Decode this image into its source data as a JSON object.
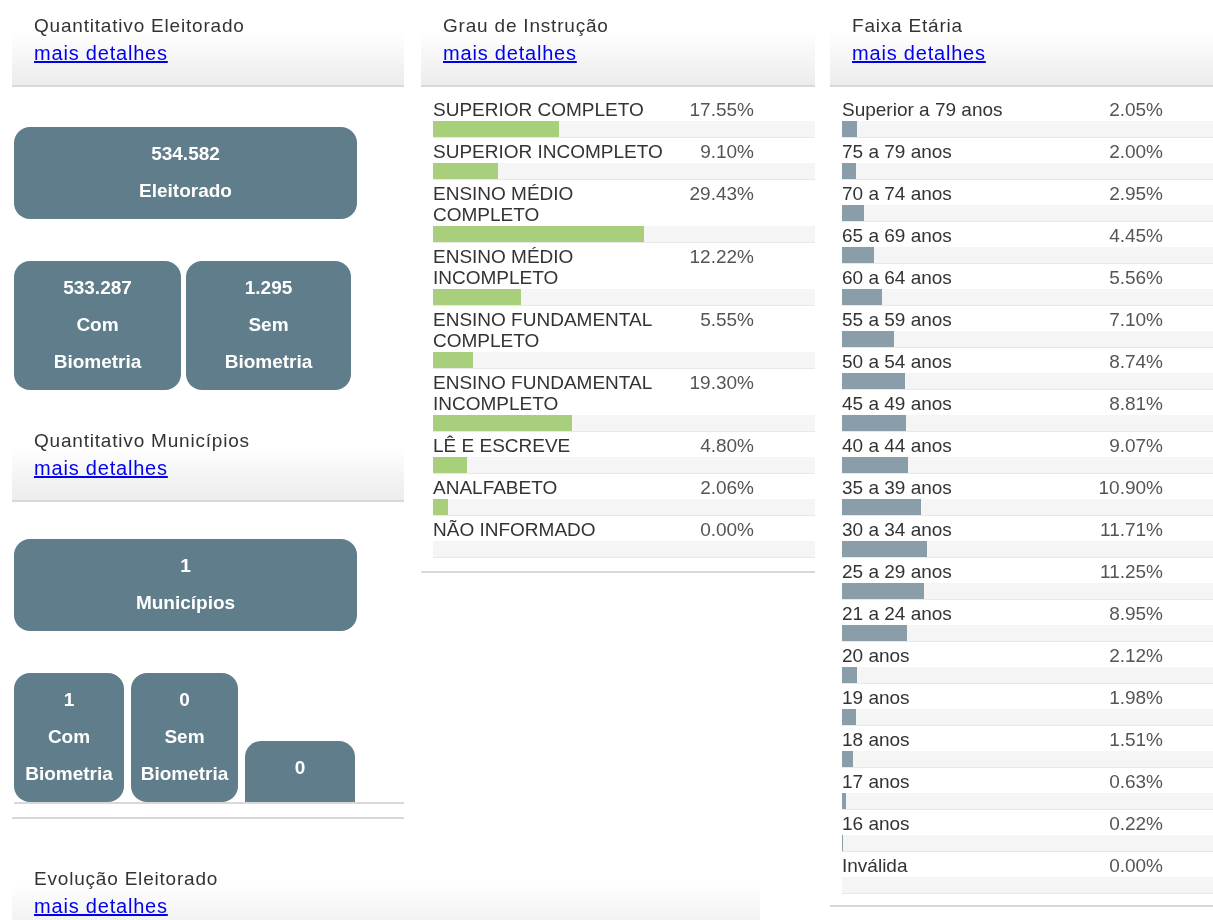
{
  "eleitorado": {
    "title": "Quantitativo Eleitorado",
    "link": "mais detalhes",
    "total": {
      "value": "534.582",
      "label": "Eleitorado"
    },
    "cards": [
      {
        "value": "533.287",
        "label": "Com Biometria"
      },
      {
        "value": "1.295",
        "label": "Sem Biometria"
      }
    ]
  },
  "municipios": {
    "title": "Quantitativo Municípios",
    "link": "mais detalhes",
    "total": {
      "value": "1",
      "label": "Municípios"
    },
    "cards": [
      {
        "value": "1",
        "label": "Com Biometria"
      },
      {
        "value": "0",
        "label": "Sem Biometria"
      },
      {
        "value": "0"
      }
    ]
  },
  "evolucao": {
    "title": "Evolução Eleitorado",
    "link": "mais detalhes"
  },
  "instrucao": {
    "title": "Grau de Instrução",
    "link": "mais detalhes",
    "rows": [
      {
        "label": "SUPERIOR COMPLETO",
        "percent": "17.55%",
        "level": 0.33
      },
      {
        "label": "SUPERIOR INCOMPLETO",
        "percent": "9.10%",
        "level": 0.17
      },
      {
        "label": "ENSINO MÉDIO COMPLETO",
        "percent": "29.43%",
        "level": 0.553
      },
      {
        "label": "ENSINO MÉDIO INCOMPLETO",
        "percent": "12.22%",
        "level": 0.23
      },
      {
        "label": "ENSINO FUNDAMENTAL COMPLETO",
        "percent": "5.55%",
        "level": 0.104
      },
      {
        "label": "ENSINO FUNDAMENTAL INCOMPLETO",
        "percent": "19.30%",
        "level": 0.363
      },
      {
        "label": "LÊ E ESCREVE",
        "percent": "4.80%",
        "level": 0.09
      },
      {
        "label": "ANALFABETO",
        "percent": "2.06%",
        "level": 0.039
      },
      {
        "label": "NÃO INFORMADO",
        "percent": "0.00%"
      }
    ]
  },
  "faixa": {
    "title": "Faixa Etária",
    "link": "mais detalhes",
    "rows": [
      {
        "label": "Superior a 79 anos",
        "percent": "2.05%",
        "level": 0.04
      },
      {
        "label": "75 a 79 anos",
        "percent": "2.00%",
        "level": 0.039
      },
      {
        "label": "70 a 74 anos",
        "percent": "2.95%",
        "level": 0.058
      },
      {
        "label": "65 a 69 anos",
        "percent": "4.45%",
        "level": 0.087
      },
      {
        "label": "60 a 64 anos",
        "percent": "5.56%",
        "level": 0.109
      },
      {
        "label": "55 a 59 anos",
        "percent": "7.10%",
        "level": 0.139
      },
      {
        "label": "50 a 54 anos",
        "percent": "8.74%",
        "level": 0.171
      },
      {
        "label": "45 a 49 anos",
        "percent": "8.81%",
        "level": 0.172
      },
      {
        "label": "40 a 44 anos",
        "percent": "9.07%",
        "level": 0.177
      },
      {
        "label": "35 a 39 anos",
        "percent": "10.90%",
        "level": 0.213
      },
      {
        "label": "30 a 34 anos",
        "percent": "11.71%",
        "level": 0.229
      },
      {
        "label": "25 a 29 anos",
        "percent": "11.25%",
        "level": 0.22
      },
      {
        "label": "21 a 24 anos",
        "percent": "8.95%",
        "level": 0.175
      },
      {
        "label": "20 anos",
        "percent": "2.12%",
        "level": 0.041
      },
      {
        "label": "19 anos",
        "percent": "1.98%",
        "level": 0.039
      },
      {
        "label": "18 anos",
        "percent": "1.51%",
        "level": 0.03
      },
      {
        "label": "17 anos",
        "percent": "0.63%",
        "level": 0.012
      },
      {
        "label": "16 anos",
        "percent": "0.22%",
        "level": 0.004
      },
      {
        "label": "Inválida",
        "percent": "0.00%"
      }
    ]
  }
}
